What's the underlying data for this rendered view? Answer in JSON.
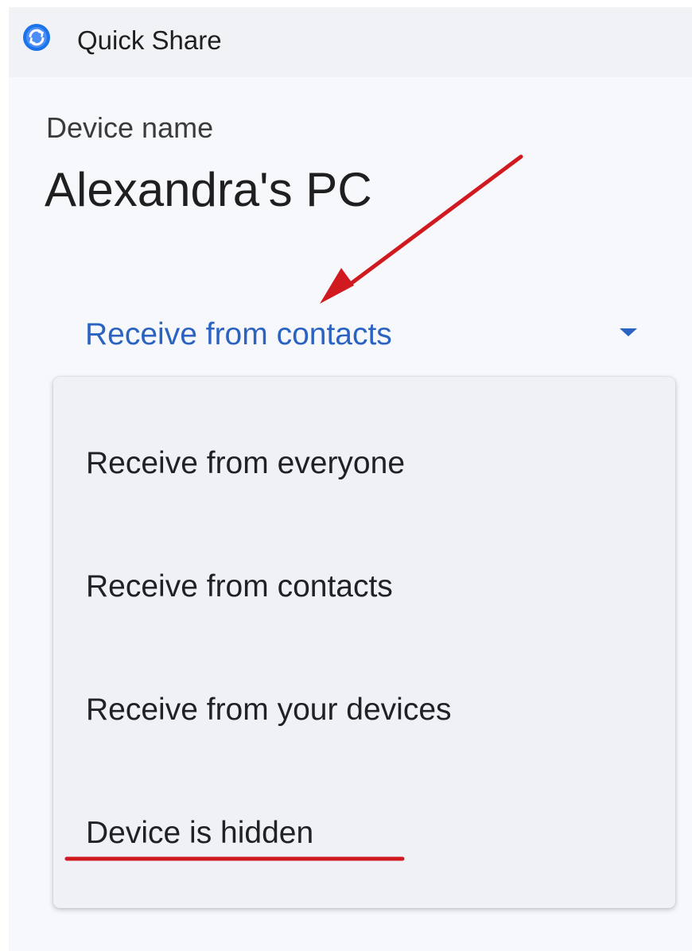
{
  "app": {
    "title": "Quick Share",
    "icon": "quick-share-icon",
    "accent_color": "#2a63c1"
  },
  "device": {
    "label": "Device name",
    "name": "Alexandra's PC"
  },
  "visibility_dropdown": {
    "selected": "Receive from contacts",
    "icon": "caret-down-icon"
  },
  "visibility_menu": {
    "options": [
      {
        "label": "Receive from everyone"
      },
      {
        "label": "Receive from contacts"
      },
      {
        "label": "Receive from your devices"
      },
      {
        "label": "Device is hidden"
      }
    ]
  },
  "annotations": {
    "color": "#d11a20"
  }
}
